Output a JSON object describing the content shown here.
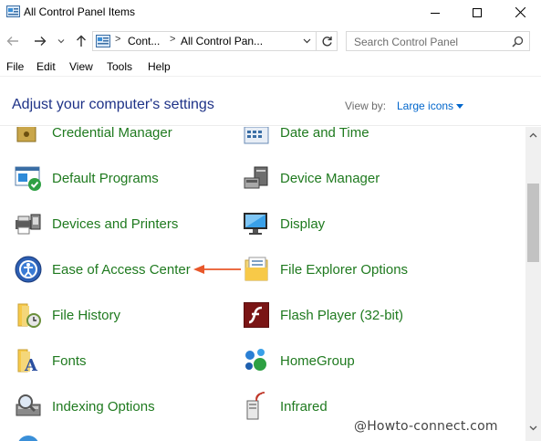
{
  "window": {
    "title": "All Control Panel Items"
  },
  "address": {
    "crumbs": [
      "Cont...",
      "All Control Pan..."
    ]
  },
  "search": {
    "placeholder": "Search Control Panel"
  },
  "menu": [
    "File",
    "Edit",
    "View",
    "Tools",
    "Help"
  ],
  "header": {
    "title": "Adjust your computer's settings",
    "view_by_label": "View by:",
    "view_by_value": "Large icons"
  },
  "items": [
    {
      "label": "Credential Manager",
      "icon": "credential-manager-icon"
    },
    {
      "label": "Date and Time",
      "icon": "date-time-icon"
    },
    {
      "label": "Default Programs",
      "icon": "default-programs-icon"
    },
    {
      "label": "Device Manager",
      "icon": "device-manager-icon"
    },
    {
      "label": "Devices and Printers",
      "icon": "devices-printers-icon"
    },
    {
      "label": "Display",
      "icon": "display-icon"
    },
    {
      "label": "Ease of Access Center",
      "icon": "ease-of-access-icon"
    },
    {
      "label": "File Explorer Options",
      "icon": "file-explorer-options-icon"
    },
    {
      "label": "File History",
      "icon": "file-history-icon"
    },
    {
      "label": "Flash Player (32-bit)",
      "icon": "flash-player-icon"
    },
    {
      "label": "Fonts",
      "icon": "fonts-icon"
    },
    {
      "label": "HomeGroup",
      "icon": "homegroup-icon"
    },
    {
      "label": "Indexing Options",
      "icon": "indexing-options-icon"
    },
    {
      "label": "Infrared",
      "icon": "infrared-icon"
    }
  ],
  "watermark": "@Howto-connect.com",
  "colors": {
    "title_blue": "#1e3287",
    "link_green": "#1f7a1f",
    "link_blue": "#0066cc",
    "annotation_arrow": "#e8572a"
  }
}
